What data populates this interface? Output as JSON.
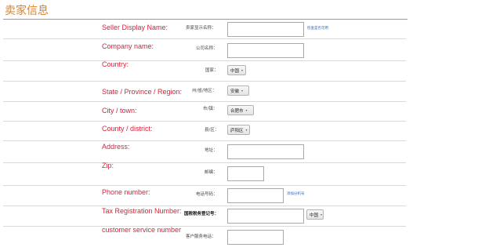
{
  "page_title": "卖家信息",
  "fields": {
    "seller_display_name": {
      "en": "Seller Display Name:",
      "cn": "卖家显示名称：",
      "link": "检查是否可用",
      "value": ""
    },
    "company_name": {
      "en": "Company name:",
      "cn": "公司名称：",
      "value": ""
    },
    "country": {
      "en": "Country:",
      "cn": "国家：",
      "selected": "中国"
    },
    "state": {
      "en": "State / Province / Region:",
      "cn": "州/省/地区：",
      "selected": "安徽"
    },
    "city": {
      "en": "City / town:",
      "cn": "市/镇：",
      "selected": "合肥市"
    },
    "county": {
      "en": "County / district:",
      "cn": "县/区：",
      "selected": "庐阳区"
    },
    "address": {
      "en": "Address:",
      "cn": "地址：",
      "value": ""
    },
    "zip": {
      "en": "Zip:",
      "cn": "邮编：",
      "value": ""
    },
    "phone": {
      "en": "Phone number:",
      "cn": "电话号码：",
      "link": "添加分机号",
      "value": ""
    },
    "tax": {
      "en": "Tax Registration Number:",
      "cn": "国税税务登记号：",
      "selected": "中国",
      "value": ""
    },
    "customer_service": {
      "en": "customer service number",
      "cn": "客户服务电话：",
      "value": ""
    }
  }
}
